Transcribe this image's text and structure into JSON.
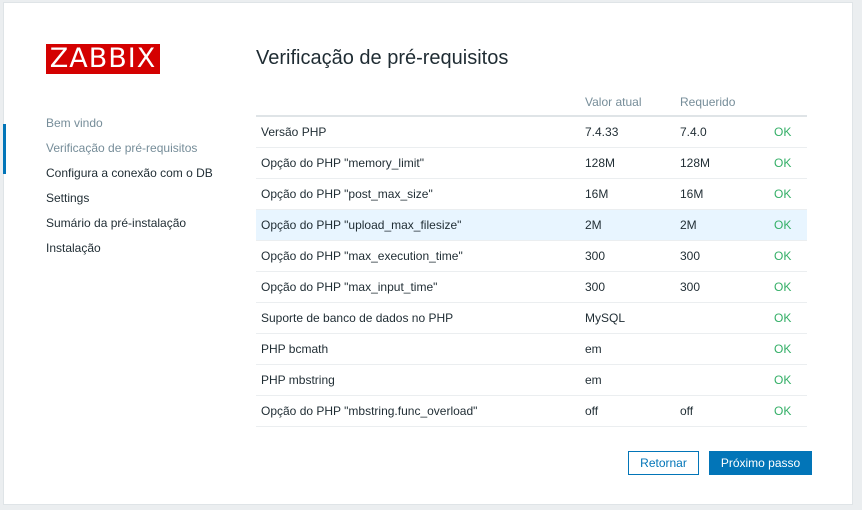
{
  "logo": "ZABBIX",
  "title": "Verificação de pré-requisitos",
  "nav": [
    {
      "label": "Bem vindo"
    },
    {
      "label": "Verificação de pré-requisitos"
    },
    {
      "label": "Configura a conexão com o DB"
    },
    {
      "label": "Settings"
    },
    {
      "label": "Sumário da pré-instalação"
    },
    {
      "label": "Instalação"
    }
  ],
  "table": {
    "headers": [
      "",
      "Valor atual",
      "Requerido",
      ""
    ],
    "rows": [
      [
        "Versão PHP",
        "7.4.33",
        "7.4.0",
        "OK"
      ],
      [
        "Opção do PHP \"memory_limit\"",
        "128M",
        "128M",
        "OK"
      ],
      [
        "Opção do PHP \"post_max_size\"",
        "16M",
        "16M",
        "OK"
      ],
      [
        "Opção do PHP \"upload_max_filesize\"",
        "2M",
        "2M",
        "OK"
      ],
      [
        "Opção do PHP \"max_execution_time\"",
        "300",
        "300",
        "OK"
      ],
      [
        "Opção do PHP \"max_input_time\"",
        "300",
        "300",
        "OK"
      ],
      [
        "Suporte de banco de dados no PHP",
        "MySQL",
        "",
        "OK"
      ],
      [
        "PHP bcmath",
        "em",
        "",
        "OK"
      ],
      [
        "PHP mbstring",
        "em",
        "",
        "OK"
      ],
      [
        "Opção do PHP \"mbstring.func_overload\"",
        "off",
        "off",
        "OK"
      ]
    ]
  },
  "buttons": {
    "back": "Retornar",
    "next": "Próximo passo"
  },
  "colors": {
    "brand": "#d40000",
    "accent": "#0275b8",
    "ok": "#34af67",
    "highlight_row": "#e8f5ff"
  }
}
